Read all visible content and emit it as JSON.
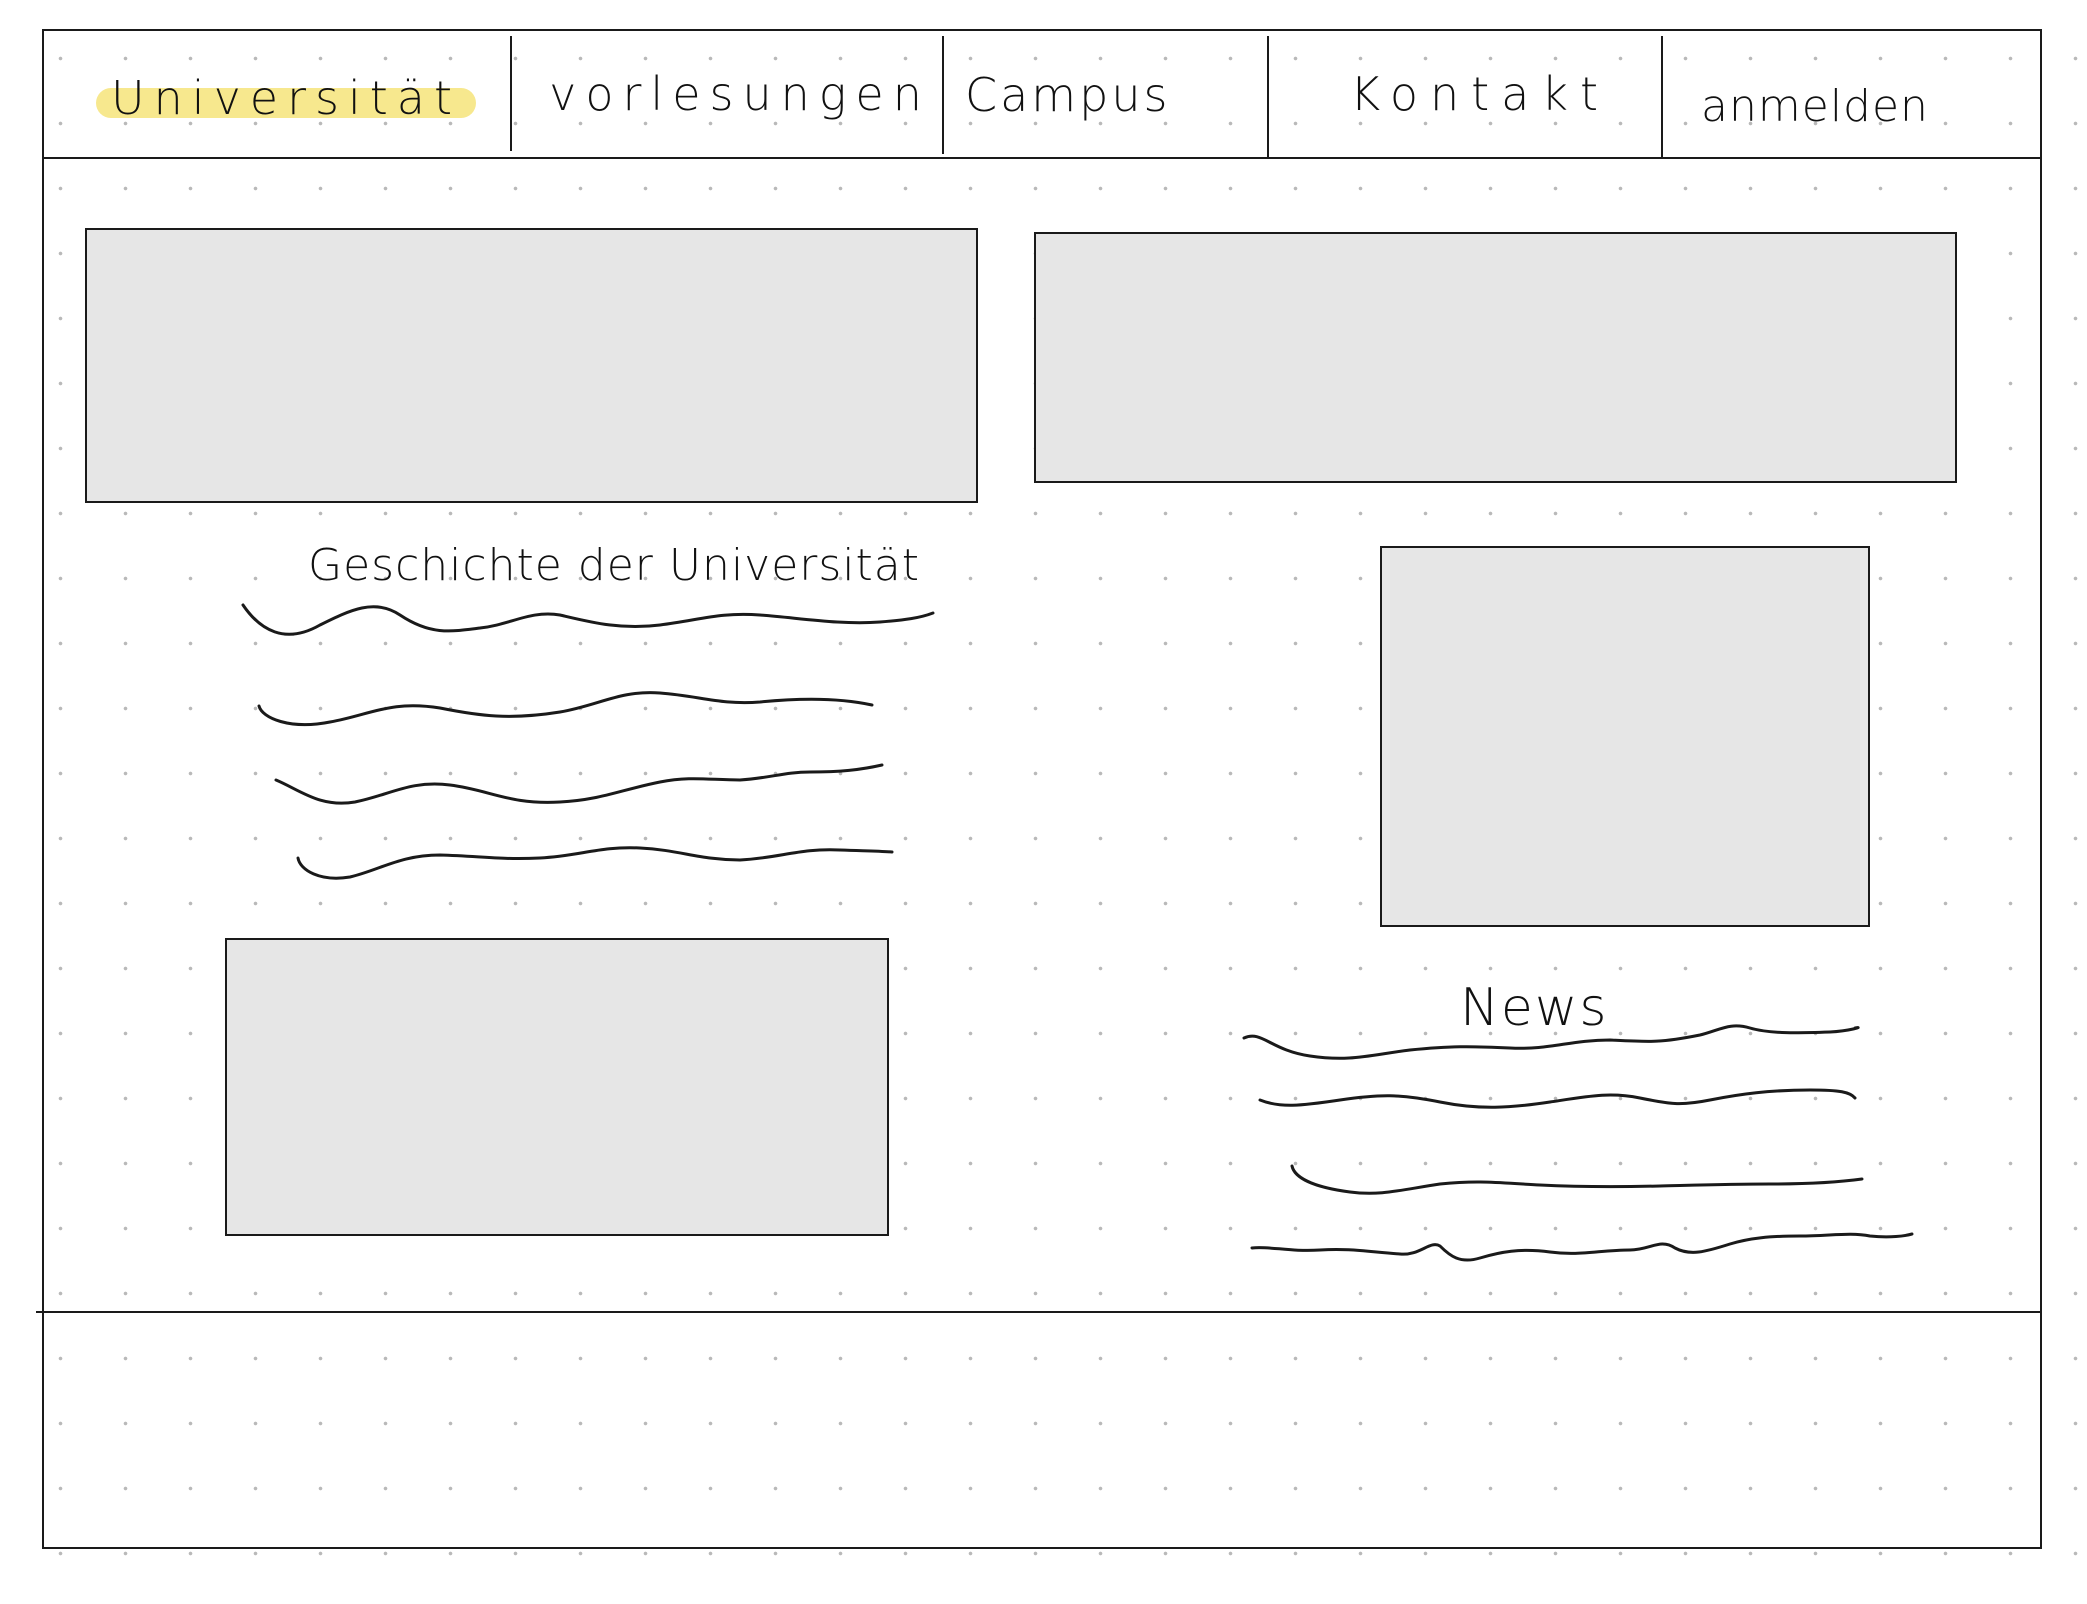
{
  "nav": {
    "items": [
      {
        "label": "Universität"
      },
      {
        "label": "vorlesungen"
      },
      {
        "label": "Campus"
      },
      {
        "label": "Kontakt"
      },
      {
        "label": "anmelden"
      }
    ],
    "active_highlight_color": "#f7e88e"
  },
  "main": {
    "history_section": {
      "heading": "Geschichte der Universität"
    },
    "news_section": {
      "heading": "News"
    },
    "placeholder_fill": "#e6e6e6"
  }
}
